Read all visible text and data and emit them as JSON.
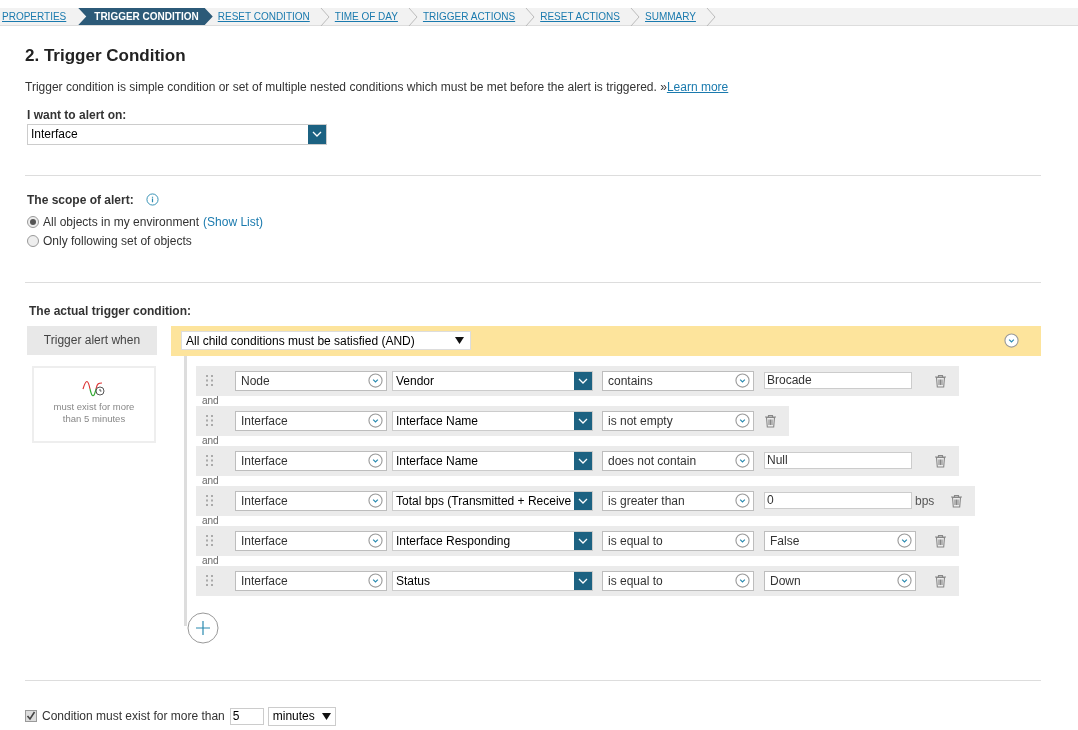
{
  "breadcrumbs": [
    {
      "label": "PROPERTIES",
      "selected": false
    },
    {
      "label": "TRIGGER CONDITION",
      "selected": true
    },
    {
      "label": "RESET CONDITION",
      "selected": false
    },
    {
      "label": "TIME OF DAY",
      "selected": false
    },
    {
      "label": "TRIGGER ACTIONS",
      "selected": false
    },
    {
      "label": "RESET ACTIONS",
      "selected": false
    },
    {
      "label": "SUMMARY",
      "selected": false
    }
  ],
  "title": "2. Trigger Condition",
  "description": "Trigger condition is simple condition or set of multiple nested conditions which must be met before the alert is triggered. »",
  "learn_more": "Learn more",
  "alert_on": {
    "label": "I want to alert on:",
    "value": "Interface"
  },
  "scope": {
    "label": "The scope of alert:",
    "options": [
      {
        "label": "All objects in my environment",
        "link": "(Show List)",
        "selected": true
      },
      {
        "label": "Only following set of objects",
        "selected": false
      }
    ]
  },
  "trigger": {
    "label": "The actual trigger condition:",
    "when_label": "Trigger alert when",
    "mode": "All child conditions must be satisfied (AND)",
    "duration_note": "must exist for more than 5 minutes",
    "conditions": [
      {
        "object": "Node",
        "field": "Vendor",
        "operator": "contains",
        "kind": "text",
        "value": "Brocade"
      },
      {
        "joiner": "and",
        "object": "Interface",
        "field": "Interface Name",
        "operator": "is not empty",
        "kind": "none"
      },
      {
        "joiner": "and",
        "object": "Interface",
        "field": "Interface Name",
        "operator": "does not contain",
        "kind": "text",
        "value": "Null"
      },
      {
        "joiner": "and",
        "object": "Interface",
        "field": "Total bps (Transmitted + Receive",
        "operator": "is greater than",
        "kind": "unit",
        "value": "0",
        "unit": "bps"
      },
      {
        "joiner": "and",
        "object": "Interface",
        "field": "Interface Responding",
        "operator": "is equal to",
        "kind": "select",
        "value": "False"
      },
      {
        "joiner": "and",
        "object": "Interface",
        "field": "Status",
        "operator": "is equal to",
        "kind": "select",
        "value": "Down"
      }
    ]
  },
  "must_exist": {
    "checked": true,
    "label": "Condition must exist for more than",
    "value": "5",
    "unit": "minutes"
  }
}
